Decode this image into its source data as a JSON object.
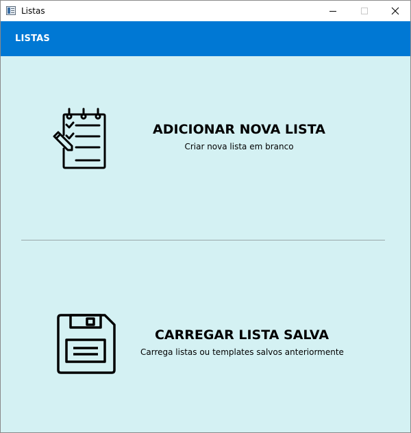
{
  "window": {
    "title": "Listas"
  },
  "header": {
    "title": "LISTAS"
  },
  "options": {
    "new_list": {
      "title": "ADICIONAR NOVA LISTA",
      "description": "Criar nova lista em branco",
      "icon": "notepad-checklist-icon"
    },
    "load_list": {
      "title": "CARREGAR LISTA SALVA",
      "description": "Carrega listas ou templates salvos anteriormente",
      "icon": "floppy-disk-icon"
    }
  },
  "colors": {
    "header": "#0078d4",
    "background": "#d4f1f3"
  }
}
